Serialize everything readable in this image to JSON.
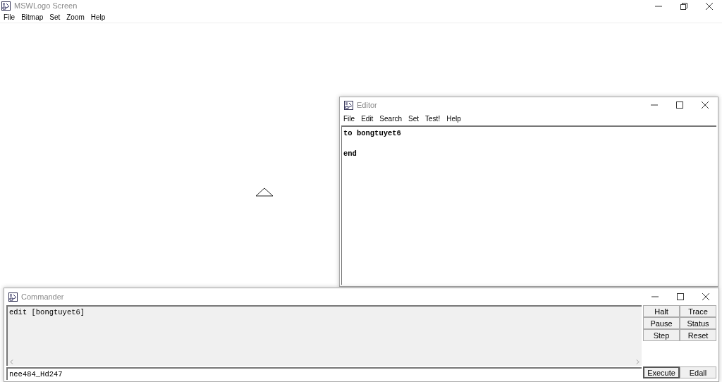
{
  "main_window": {
    "title": "MSWLogo Screen",
    "menu": [
      "File",
      "Bitmap",
      "Set",
      "Zoom",
      "Help"
    ]
  },
  "editor": {
    "title": "Editor",
    "menu": [
      "File",
      "Edit",
      "Search",
      "Set",
      "Test!",
      "Help"
    ],
    "text": "to bongtuyet6\n\nend"
  },
  "commander": {
    "title": "Commander",
    "output": "edit [bongtuyet6]",
    "input": {
      "value": "nee484_Hd247"
    },
    "buttons": [
      {
        "label": "Halt"
      },
      {
        "label": "Trace"
      },
      {
        "label": "Pause"
      },
      {
        "label": "Status"
      },
      {
        "label": "Step"
      },
      {
        "label": "Reset"
      }
    ],
    "bottom_buttons": [
      {
        "label": "Execute",
        "kind": "default"
      },
      {
        "label": "Edall",
        "kind": "normal"
      }
    ]
  }
}
